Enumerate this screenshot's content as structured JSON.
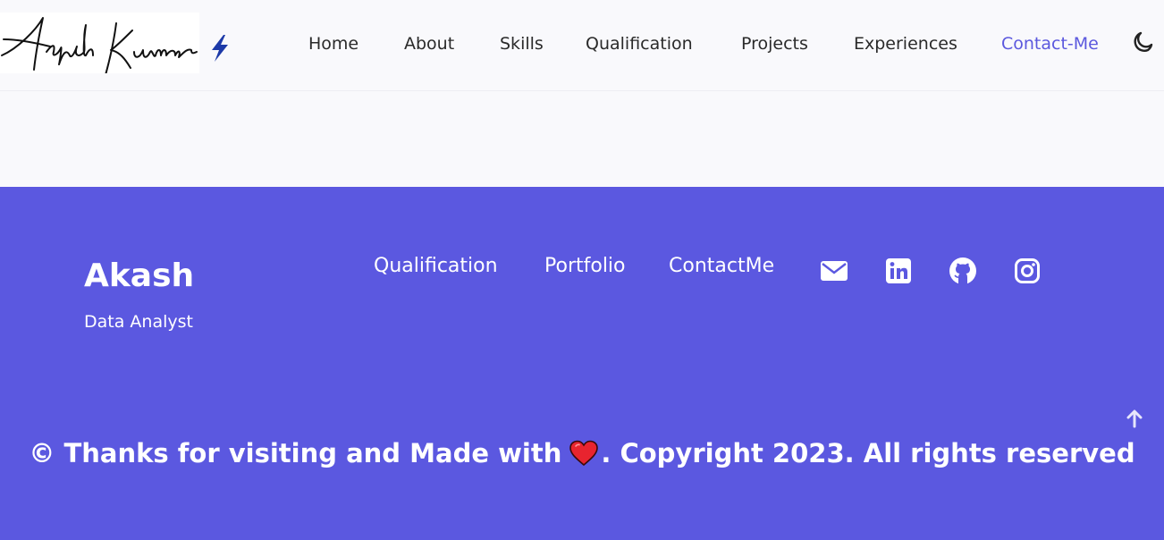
{
  "header": {
    "logo_signature": "Akash Kumar",
    "nav": [
      {
        "label": "Home"
      },
      {
        "label": "About"
      },
      {
        "label": "Skills"
      },
      {
        "label": "Qualification"
      },
      {
        "label": "Projects"
      },
      {
        "label": "Experiences"
      },
      {
        "label": "Contact-Me"
      }
    ],
    "active_nav": "Contact-Me",
    "theme_toggle_icon": "moon-icon",
    "logo_accent_icon": "bolt-icon"
  },
  "footer": {
    "brand": "Akash",
    "tagline": "Data Analyst",
    "links": [
      {
        "label": "Qualification"
      },
      {
        "label": "Portfolio"
      },
      {
        "label": "ContactMe"
      }
    ],
    "social_icons": [
      "envelope-icon",
      "linkedin-icon",
      "github-icon",
      "instagram-icon"
    ],
    "copyright_before": "© Thanks for visiting and Made with",
    "copyright_after": ". Copyright 2023. All rights reserved",
    "heart_icon": "heart-icon",
    "scroll_top_icon": "arrow-up-icon"
  },
  "colors": {
    "accent": "#5b58e0",
    "active_nav": "#5b58de",
    "header_bg": "#f9f9fc",
    "bolt": "#1d3aa8",
    "heart": "#e8242f"
  }
}
